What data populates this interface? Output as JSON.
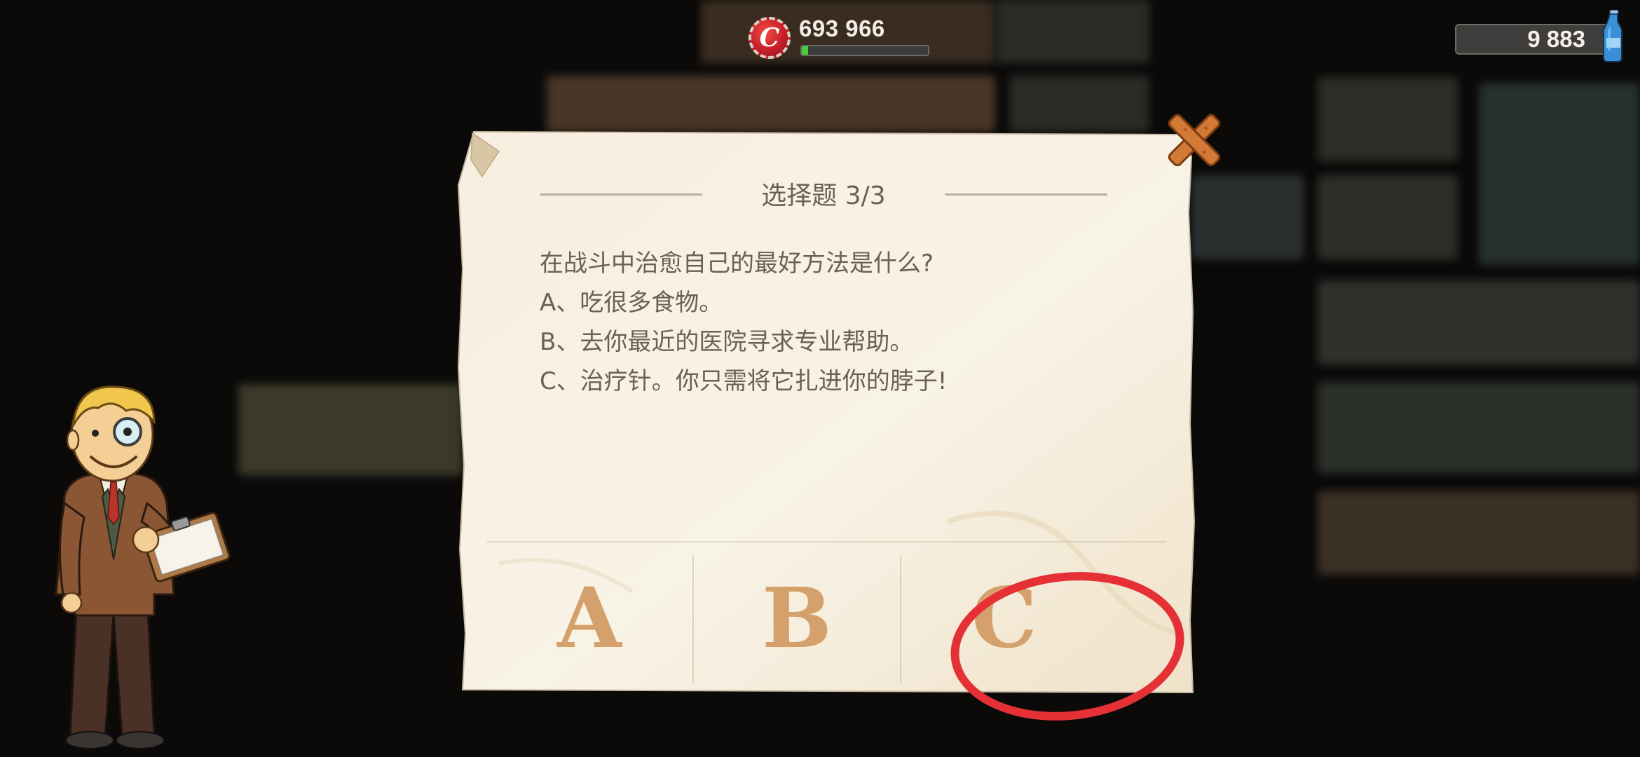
{
  "hud": {
    "caps_icon": "bottle-cap-icon",
    "caps_symbol": "C",
    "caps_value": "693 966",
    "caps_progress": 0.05,
    "nuka_value": "9 883",
    "nuka_icon": "nuka-cola-quantum-icon"
  },
  "dialog": {
    "title": "选择题 3/3",
    "question": "在战斗中治愈自己的最好方法是什么?",
    "options": [
      "A、吃很多食物。",
      "B、去你最近的医院寻求专业帮助。",
      "C、治疗针。你只需将它扎进你的脖子!"
    ],
    "answer_buttons": [
      "A",
      "B",
      "C"
    ],
    "close_icon": "close-x-icon"
  },
  "colors": {
    "paper": "#f5eedf",
    "paper_text": "#6d5f53",
    "answer_letter": "#d4a06c",
    "close_orange": "#d27a35",
    "highlight": "#e53036",
    "caps_red": "#c8202a",
    "progress_green": "#3fd23a"
  }
}
